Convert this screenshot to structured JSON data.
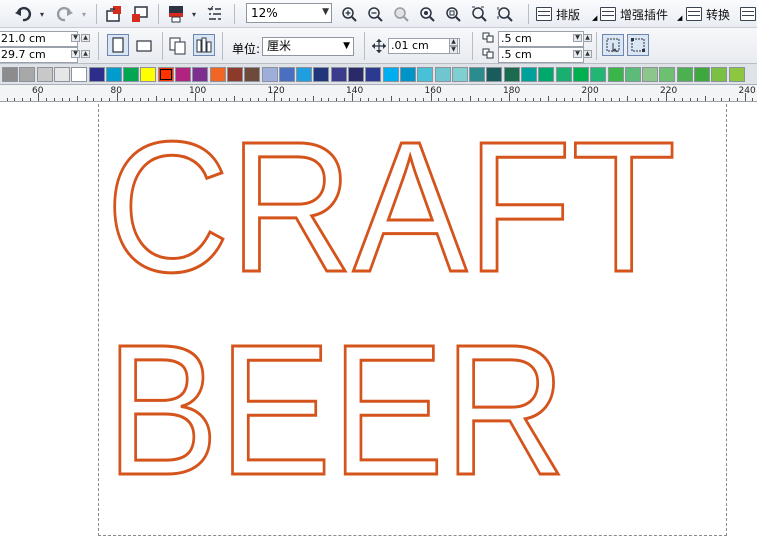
{
  "toolbar": {
    "zoom_value": "12%",
    "buttons": [
      {
        "name": "undo-button",
        "icon": "undo-icon"
      },
      {
        "name": "redo-button",
        "icon": "redo-icon"
      },
      {
        "name": "import-button",
        "icon": "import-icon"
      },
      {
        "name": "export-button",
        "icon": "export-icon"
      },
      {
        "name": "publish-button",
        "icon": "publish-icon"
      },
      {
        "name": "options-button",
        "icon": "options-icon"
      },
      {
        "name": "zoom-in-button",
        "icon": "zoom-in-icon"
      },
      {
        "name": "zoom-out-button",
        "icon": "zoom-out-icon"
      },
      {
        "name": "zoom-selected-button",
        "icon": "zoom-selected-icon"
      },
      {
        "name": "zoom-all-button",
        "icon": "zoom-all-icon"
      },
      {
        "name": "zoom-page-button",
        "icon": "zoom-page-icon"
      },
      {
        "name": "zoom-width-button",
        "icon": "zoom-width-icon"
      },
      {
        "name": "zoom-height-button",
        "icon": "zoom-height-icon"
      }
    ],
    "text_buttons": [
      {
        "label": "排版",
        "icon": "layout-icon"
      },
      {
        "label": "增强插件",
        "icon": "plugin-icon"
      },
      {
        "label": "转换",
        "icon": "convert-icon"
      }
    ]
  },
  "property_bar": {
    "page_width": "21.0 cm",
    "page_height": "29.7 cm",
    "unit_label": "单位:",
    "unit_value": "厘米",
    "nudge_value": ".01 cm",
    "duplicate_x": ".5 cm",
    "duplicate_y": ".5 cm"
  },
  "palette": {
    "colors": [
      "#8c8c8c",
      "#a8a8a8",
      "#c8c8c8",
      "#e6e6e6",
      "#ffffff",
      "#2d2d8c",
      "#009ccc",
      "#00a650",
      "#ffff00",
      "#ff3300",
      "#b0237e",
      "#7d2f8f",
      "#f26522",
      "#8c3a2a",
      "#6d4a3a",
      "#9eaedb",
      "#4a6fc0",
      "#1f9fe0",
      "#20357a",
      "#3c3c8c",
      "#2a2a6a",
      "#2b3990",
      "#00aeef",
      "#0095c8",
      "#48c0d8",
      "#6fc6cf",
      "#7fcfd0",
      "#2a8c8c",
      "#1a5c5c",
      "#1b6b4f",
      "#00a19a",
      "#00a86b",
      "#1aae6f",
      "#00b050",
      "#22b573",
      "#39b54a",
      "#5dbb7a",
      "#8cc68a",
      "#6cc070",
      "#4caf50",
      "#3ea83e",
      "#7ac143",
      "#8dc63f"
    ],
    "selected_index": 9
  },
  "ruler": {
    "labels": [
      "60",
      "80",
      "100",
      "120",
      "140",
      "160",
      "180",
      "200",
      "220",
      "240"
    ]
  },
  "canvas": {
    "stroke_color": "#d4541c",
    "line1": "CRAFT",
    "line2": "BEER"
  }
}
